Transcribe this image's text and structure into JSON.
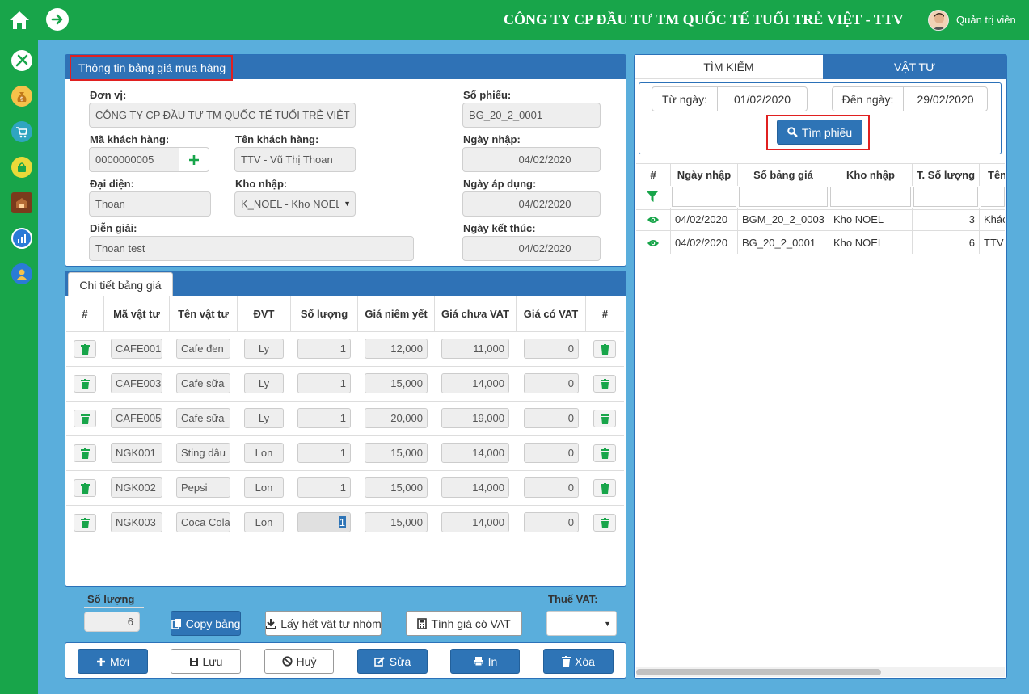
{
  "header": {
    "company": "CÔNG TY CP ĐẦU TƯ TM QUỐC TẾ TUỔI TRẺ VIỆT - TTV",
    "user": "Quản trị viên",
    "icons": [
      "home-icon",
      "arrow-right-icon",
      "avatar"
    ]
  },
  "sidebar": {
    "icons": [
      "tools-icon",
      "money-bag-icon",
      "cart-icon",
      "shopping-bag-icon",
      "warehouse-icon",
      "chart-icon",
      "user-icon"
    ]
  },
  "info": {
    "title": "Thông tin bảng giá mua hàng",
    "don_vi_label": "Đơn vị:",
    "don_vi": "CÔNG TY CP ĐẦU TƯ TM QUỐC TẾ TUỔI TRẺ VIỆT",
    "ma_kh_label": "Mã khách hàng:",
    "ma_kh": "0000000005",
    "ten_kh_label": "Tên khách hàng:",
    "ten_kh": "TTV - Vũ Thị Thoan",
    "dai_dien_label": "Đại diện:",
    "dai_dien": "Thoan",
    "kho_label": "Kho nhập:",
    "kho": "K_NOEL - Kho NOEL",
    "dien_giai_label": "Diễn giải:",
    "dien_giai": "Thoan test",
    "so_phieu_label": "Số phiếu:",
    "so_phieu": "BG_20_2_0001",
    "ngay_nhap_label": "Ngày nhập:",
    "ngay_nhap": "04/02/2020",
    "ngay_ap_dung_label": "Ngày áp dụng:",
    "ngay_ap_dung": "04/02/2020",
    "ngay_ket_thuc_label": "Ngày kết thúc:",
    "ngay_ket_thuc": "04/02/2020"
  },
  "detail": {
    "tab": "Chi tiết bảng giá",
    "columns": [
      "#",
      "Mã vật tư",
      "Tên vật tư",
      "ĐVT",
      "Số lượng",
      "Giá niêm yết",
      "Giá chưa VAT",
      "Giá có VAT",
      "#"
    ],
    "rows": [
      {
        "ma": "CAFE001",
        "ten": "Cafe đen",
        "dvt": "Ly",
        "sl": "1",
        "gia_ny": "12,000",
        "gia_chua": "11,000",
        "gia_co": "0"
      },
      {
        "ma": "CAFE003",
        "ten": "Cafe sữa",
        "dvt": "Ly",
        "sl": "1",
        "gia_ny": "15,000",
        "gia_chua": "14,000",
        "gia_co": "0"
      },
      {
        "ma": "CAFE005",
        "ten": "Cafe  sữa",
        "dvt": "Ly",
        "sl": "1",
        "gia_ny": "20,000",
        "gia_chua": "19,000",
        "gia_co": "0"
      },
      {
        "ma": "NGK001",
        "ten": "Sting dâu",
        "dvt": "Lon",
        "sl": "1",
        "gia_ny": "15,000",
        "gia_chua": "14,000",
        "gia_co": "0"
      },
      {
        "ma": "NGK002",
        "ten": "Pepsi",
        "dvt": "Lon",
        "sl": "1",
        "gia_ny": "15,000",
        "gia_chua": "14,000",
        "gia_co": "0"
      },
      {
        "ma": "NGK003",
        "ten": "Coca Cola",
        "dvt": "Lon",
        "sl": "1",
        "gia_ny": "15,000",
        "gia_chua": "14,000",
        "gia_co": "0"
      }
    ]
  },
  "footer": {
    "so_luong_label": "Số lượng",
    "so_luong": "6",
    "copy": "Copy bảng",
    "lay_het": "Lấy hết vật tư nhóm",
    "tinh_gia": "Tính giá có VAT",
    "thue_label": "Thuế VAT:",
    "moi": "Mới",
    "luu": "Lưu",
    "huy": "Huỷ",
    "sua": "Sửa",
    "in": "In",
    "xoa": "Xóa"
  },
  "search": {
    "tab_search": "TÌM KIẾM",
    "tab_vattu": "VẬT TƯ",
    "tu_ngay_label": "Từ ngày:",
    "tu_ngay": "01/02/2020",
    "den_ngay_label": "Đến ngày:",
    "den_ngay": "29/02/2020",
    "button": "Tìm phiếu",
    "columns": [
      "#",
      "Ngày nhập",
      "Số bảng giá",
      "Kho nhập",
      "T. Số lượng",
      "Tên"
    ],
    "rows": [
      {
        "ngay": "04/02/2020",
        "so": "BGM_20_2_0003",
        "kho": "Kho NOEL",
        "sl": "3",
        "ten": "Khách"
      },
      {
        "ngay": "04/02/2020",
        "so": "BG_20_2_0001",
        "kho": "Kho NOEL",
        "sl": "6",
        "ten": "TTV"
      }
    ]
  },
  "colors": {
    "green": "#18a54a",
    "blue": "#2e74b6",
    "background": "#5aaedc",
    "highlight": "#e02020"
  }
}
